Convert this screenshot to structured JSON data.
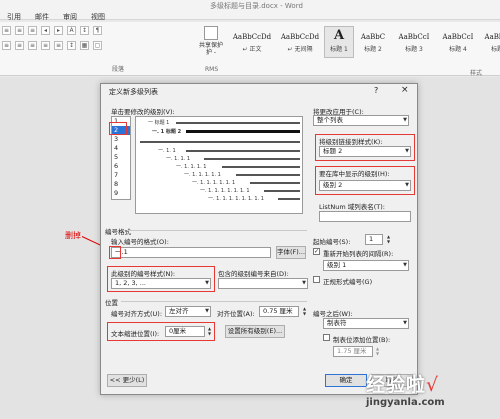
{
  "window": {
    "title": "多级标题与目录.docx - Word"
  },
  "ribbon": {
    "tabs": [
      "引用",
      "邮件",
      "审阅",
      "视图"
    ],
    "share_label": "共享保护",
    "share_sub": "护 -",
    "rms_label": "RMS",
    "paragraph_label": "段落",
    "styles_label": "样式",
    "styles": [
      {
        "sample": "AaBbCcDd",
        "name": "↵ 正文"
      },
      {
        "sample": "AaBbCcDd",
        "name": "↵ 无间隔"
      },
      {
        "sample": "A",
        "name": "标题 1"
      },
      {
        "sample": "AaBbC",
        "name": "标题 2"
      },
      {
        "sample": "AaBbCcI",
        "name": "标题 3"
      },
      {
        "sample": "AaBbCcI",
        "name": "标题 4"
      },
      {
        "sample": "AaBbCcI",
        "name": "标题 5"
      }
    ]
  },
  "annotation": {
    "delete_note": "删掉"
  },
  "dialog": {
    "title": "定义新多级列表",
    "help": "?",
    "close": "×",
    "level_label": "单击要修改的级别(V):",
    "levels": [
      "1",
      "2",
      "3",
      "4",
      "5",
      "6",
      "7",
      "8",
      "9"
    ],
    "selected_level_index": 1,
    "preview_lines": [
      "一 标题 1",
      "一. 1 标题 2",
      "一. 1. 1",
      "一. 1. 1. 1",
      "一. 1. 1. 1. 1",
      "一. 1. 1. 1. 1. 1",
      "一. 1. 1. 1. 1. 1. 1",
      "一. 1. 1. 1. 1. 1. 1. 1",
      "一. 1. 1. 1. 1. 1. 1. 1. 1"
    ],
    "apply_to_label": "将更改应用于(C):",
    "apply_to_value": "整个列表",
    "link_style_label": "将级别链接到样式(K):",
    "link_style_value": "标题 2",
    "gallery_level_label": "要在库中显示的级别(H):",
    "gallery_level_value": "级别 2",
    "listnum_label": "ListNum 域列表名(T):",
    "number_format_section": "编号格式",
    "enter_format_label": "输入编号的格式(O):",
    "enter_format_value": "一.1",
    "font_button": "字体(F)...",
    "number_style_label": "此级别的编号样式(N):",
    "number_style_value": "1, 2, 3, ...",
    "include_level_label": "包含的级别编号来自(D):",
    "start_at_label": "起始编号(S):",
    "start_at_value": "1",
    "restart_label": "重新开始列表的间隔(R):",
    "restart_value": "级别 1",
    "legal_label": "正规形式编号(G)",
    "position_section": "位置",
    "alignment_label": "编号对齐方式(U):",
    "alignment_value": "左对齐",
    "aligned_at_label": "对齐位置(A):",
    "aligned_at_value": "0.75 厘米",
    "indent_label": "文本缩进位置(I):",
    "indent_value": "0厘米",
    "set_all_button": "设置所有级别(E)...",
    "follow_label": "编号之后(W):",
    "follow_value": "制表符",
    "tab_add_label": "制表位添加位置(B):",
    "tab_add_value": "1.75 厘米",
    "less_button": "<< 更少(L)",
    "ok_button": "确定",
    "cancel_button": "取消"
  },
  "watermark": {
    "logo": "经验啦",
    "check": "√",
    "url": "jingyanla.com"
  },
  "colors": {
    "accent": "#2b73d6",
    "highlight": "#e53935"
  }
}
